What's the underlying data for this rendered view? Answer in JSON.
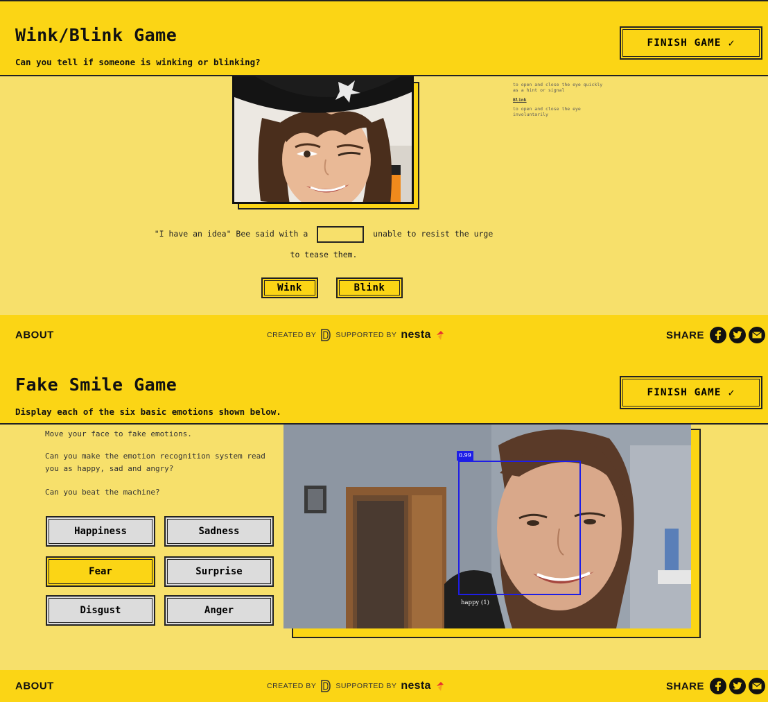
{
  "wink_game": {
    "title": "Wink/Blink Game",
    "subtitle": "Can you tell if someone is winking or blinking?",
    "finish_label": "FINISH GAME",
    "definitions": {
      "wink_text": "to open and close the eye quickly as a hint or signal",
      "blink_term": "Blink",
      "blink_text": "to open and close the eye involuntarily"
    },
    "sentence_before": "\"I have an idea\" Bee said with a",
    "sentence_after": "unable to resist the urge to tease them.",
    "choices": [
      "Wink",
      "Blink"
    ]
  },
  "smile_game": {
    "title": "Fake Smile Game",
    "subtitle": "Display each of the six basic emotions shown below.",
    "finish_label": "FINISH GAME",
    "intro": [
      "Move your face to fake emotions.",
      "Can you make the emotion recognition system read you as happy, sad and angry?",
      "Can you beat the machine?"
    ],
    "emotions": [
      "Happiness",
      "Sadness",
      "Fear",
      "Surprise",
      "Disgust",
      "Anger"
    ],
    "active_emotion": "Fear",
    "detection": {
      "score": "0.99",
      "label": "happy (1)",
      "box_color": "#1e1ee6"
    }
  },
  "footer": {
    "about": "ABOUT",
    "created_by": "CREATED BY",
    "supported_by": "SUPPORTED BY",
    "supporter": "nesta",
    "share": "SHARE",
    "share_icons": [
      "facebook-icon",
      "twitter-icon",
      "email-icon"
    ]
  },
  "colors": {
    "header_yellow": "#fbd515",
    "panel_yellow": "#f7e06b",
    "ink": "#111111"
  }
}
